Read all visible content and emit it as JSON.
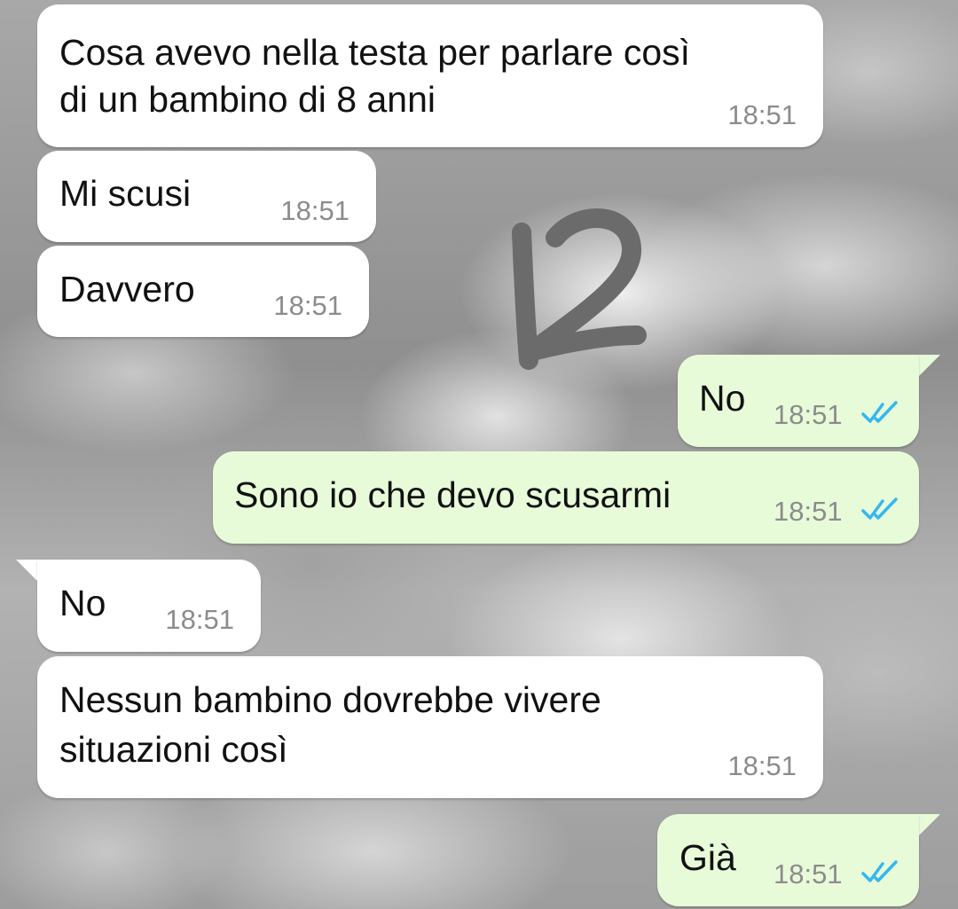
{
  "chat": {
    "messages": [
      {
        "direction": "incoming",
        "text_lines": [
          "Cosa avevo nella testa per parlare così",
          "di un bambino di 8 anni"
        ],
        "time": "18:51"
      },
      {
        "direction": "incoming",
        "text_lines": [
          "Mi scusi"
        ],
        "time": "18:51"
      },
      {
        "direction": "incoming",
        "text_lines": [
          "Davvero"
        ],
        "time": "18:51"
      },
      {
        "direction": "outgoing",
        "text_lines": [
          "No"
        ],
        "time": "18:51",
        "status": "read",
        "status_icon": "double-check-icon"
      },
      {
        "direction": "outgoing",
        "text_lines": [
          "Sono io che devo scusarmi"
        ],
        "time": "18:51",
        "status": "read",
        "status_icon": "double-check-icon"
      },
      {
        "direction": "incoming",
        "text_lines": [
          "No"
        ],
        "time": "18:51"
      },
      {
        "direction": "incoming",
        "text_lines": [
          "Nessun bambino dovrebbe vivere",
          "situazioni così"
        ],
        "time": "18:51"
      },
      {
        "direction": "outgoing",
        "text_lines": [
          "Già"
        ],
        "time": "18:51",
        "status": "read",
        "status_icon": "double-check-icon"
      }
    ]
  },
  "annotation": {
    "text": "12"
  },
  "colors": {
    "incoming_bubble": "#ffffff",
    "outgoing_bubble": "#e8fbd9",
    "read_ticks": "#34b7f1",
    "timestamp": "#8c8c8c",
    "annotation_stroke": "#6b6b6b"
  }
}
